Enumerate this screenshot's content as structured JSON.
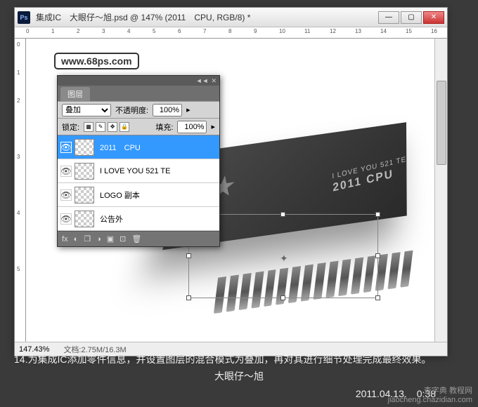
{
  "window": {
    "app_icon": "Ps",
    "title": "集成IC　大眼仔～旭.psd @ 147% (2011　CPU, RGB/8) *",
    "controls": {
      "min": "—",
      "max": "▢",
      "close": "✕"
    }
  },
  "ruler": {
    "h": [
      "0",
      "1",
      "2",
      "3",
      "4",
      "5",
      "6",
      "7",
      "8",
      "9",
      "10",
      "11",
      "12",
      "13",
      "14",
      "15",
      "16"
    ],
    "v": [
      "0",
      "1",
      "2",
      "3",
      "4",
      "5"
    ]
  },
  "canvas": {
    "watermark": "www.68ps.com",
    "chip_text_line1": "I LOVE YOU 521 TE",
    "chip_text_line2": "2011 CPU",
    "chip_star": "★"
  },
  "layers_panel": {
    "tab": "图层",
    "blend_label": "",
    "blend_mode": "叠加",
    "opacity_label": "不透明度:",
    "opacity_value": "100%",
    "lock_label": "锁定:",
    "fill_label": "填充:",
    "fill_value": "100%",
    "layers": [
      {
        "name": "2011　CPU",
        "selected": true
      },
      {
        "name": "I LOVE YOU 521 TE",
        "selected": false
      },
      {
        "name": "LOGO 副本",
        "selected": false
      },
      {
        "name": "公告外",
        "selected": false
      }
    ],
    "footer_icons": [
      "fx",
      "◐",
      "❐",
      "◑",
      "▣",
      "⊡",
      "🗑"
    ]
  },
  "status": {
    "zoom": "147.43%",
    "doc_label": "文档:",
    "doc_info": "2.75M/16.3M"
  },
  "instruction": {
    "text": "14.为集成IC添加零件信息，并设置图层的混合模式为叠加，再对其进行细节处理完成最终效果。",
    "signature": "大眼仔～旭",
    "date": "2011.04.13.　0:38"
  },
  "branding": {
    "name": "查字典",
    "sub": "教程网",
    "url": "jiaocheng.chazidian.com"
  }
}
